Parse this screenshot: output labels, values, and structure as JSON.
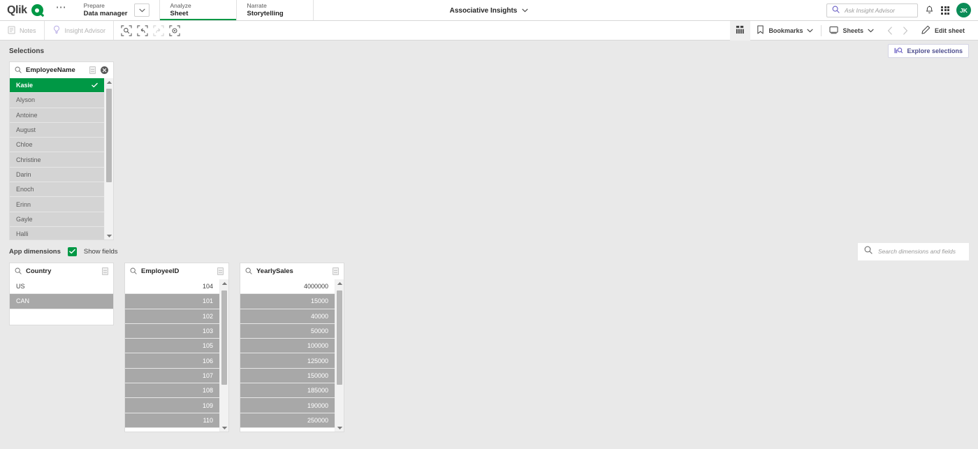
{
  "brand": {
    "word": "Qlik",
    "logo_icon": "qlik-logo-icon",
    "overflow_icon": "more-options-icon"
  },
  "nav": {
    "sections": [
      {
        "kicker": "Prepare",
        "main": "Data manager",
        "has_caret": true,
        "active": false
      },
      {
        "kicker": "Analyze",
        "main": "Sheet",
        "active": true
      },
      {
        "kicker": "Narrate",
        "main": "Storytelling",
        "active": false
      }
    ]
  },
  "app": {
    "title": "Associative Insights",
    "caret_icon": "chevron-down-icon"
  },
  "search": {
    "placeholder": "Ask Insight Advisor",
    "value": "",
    "icon": "search-icon"
  },
  "top_right": {
    "notifications_icon": "bell-icon",
    "apps_icon": "app-grid-icon",
    "avatar_initials": "JK"
  },
  "toolbar": {
    "notes_label": "Notes",
    "notes_icon": "notes-icon",
    "insight_advisor_label": "Insight Advisor",
    "insight_advisor_icon": "lightbulb-icon",
    "selection_tools": [
      {
        "name": "selection-search-tool",
        "icon": "search-in-selection-icon",
        "disabled": false
      },
      {
        "name": "step-back-tool",
        "icon": "undo-arrow-icon",
        "disabled": false
      },
      {
        "name": "step-forward-tool",
        "icon": "redo-arrow-icon",
        "disabled": true
      },
      {
        "name": "clear-selections-tool",
        "icon": "clear-all-icon",
        "disabled": false
      }
    ],
    "sheet_grid_icon": "sheet-grid-icon",
    "bookmarks_label": "Bookmarks",
    "bookmarks_icon": "bookmark-icon",
    "sheets_label": "Sheets",
    "sheets_icon": "sheet-icon",
    "prev_icon": "chevron-left-icon",
    "next_icon": "chevron-right-icon",
    "edit_sheet_label": "Edit sheet",
    "edit_sheet_icon": "pencil-icon"
  },
  "selections": {
    "label": "Selections",
    "explore_label": "Explore selections",
    "explore_icon": "explore-selections-icon"
  },
  "app_dimensions": {
    "title": "App dimensions",
    "show_fields_label": "Show fields",
    "show_fields_checked": true,
    "search_placeholder": "Search dimensions and fields",
    "search_value": ""
  },
  "colors": {
    "selected_green": "#009845",
    "excluded_gray": "#a8a8a8",
    "alternative_gray": "#d4d4d4",
    "available_white": "#ffffff",
    "accent_purple": "#4f4f8f",
    "page_background": "#e9e9e9"
  },
  "listboxes": {
    "employee_name": {
      "title": "EmployeeName",
      "search_icon": "search-icon",
      "menu_icon": "listbox-menu-icon",
      "clear_icon": "clear-selection-icon",
      "align": "left",
      "items": [
        {
          "value": "Kasie",
          "state": "selected"
        },
        {
          "value": "Alyson",
          "state": "alt"
        },
        {
          "value": "Antoine",
          "state": "alt"
        },
        {
          "value": "August",
          "state": "alt"
        },
        {
          "value": "Chloe",
          "state": "alt"
        },
        {
          "value": "Christine",
          "state": "alt"
        },
        {
          "value": "Darin",
          "state": "alt"
        },
        {
          "value": "Enoch",
          "state": "alt"
        },
        {
          "value": "Erinn",
          "state": "alt"
        },
        {
          "value": "Gayle",
          "state": "alt"
        },
        {
          "value": "Halli",
          "state": "alt"
        }
      ],
      "scroll": {
        "thumb_top_pct": 4,
        "thumb_height_pct": 58
      }
    },
    "country": {
      "title": "Country",
      "search_icon": "search-icon",
      "menu_icon": "listbox-menu-icon",
      "align": "left",
      "items": [
        {
          "value": "US",
          "state": "available"
        },
        {
          "value": "CAN",
          "state": "excluded"
        }
      ]
    },
    "employee_id": {
      "title": "EmployeeID",
      "search_icon": "search-icon",
      "menu_icon": "listbox-menu-icon",
      "align": "right",
      "items": [
        {
          "value": "104",
          "state": "available"
        },
        {
          "value": "101",
          "state": "excluded"
        },
        {
          "value": "102",
          "state": "excluded"
        },
        {
          "value": "103",
          "state": "excluded"
        },
        {
          "value": "105",
          "state": "excluded"
        },
        {
          "value": "106",
          "state": "excluded"
        },
        {
          "value": "107",
          "state": "excluded"
        },
        {
          "value": "108",
          "state": "excluded"
        },
        {
          "value": "109",
          "state": "excluded"
        },
        {
          "value": "110",
          "state": "excluded"
        }
      ],
      "scroll": {
        "thumb_top_pct": 5,
        "thumb_height_pct": 62
      }
    },
    "yearly_sales": {
      "title": "YearlySales",
      "search_icon": "search-icon",
      "menu_icon": "listbox-menu-icon",
      "align": "right",
      "items": [
        {
          "value": "4000000",
          "state": "available"
        },
        {
          "value": "15000",
          "state": "excluded"
        },
        {
          "value": "40000",
          "state": "excluded"
        },
        {
          "value": "50000",
          "state": "excluded"
        },
        {
          "value": "100000",
          "state": "excluded"
        },
        {
          "value": "125000",
          "state": "excluded"
        },
        {
          "value": "150000",
          "state": "excluded"
        },
        {
          "value": "185000",
          "state": "excluded"
        },
        {
          "value": "190000",
          "state": "excluded"
        },
        {
          "value": "250000",
          "state": "excluded"
        }
      ],
      "scroll": {
        "thumb_top_pct": 5,
        "thumb_height_pct": 62
      }
    }
  }
}
